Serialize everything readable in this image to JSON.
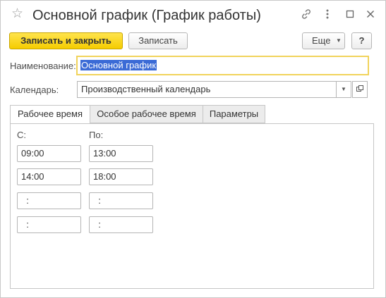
{
  "window": {
    "title": "Основной график (График работы)"
  },
  "icons": {
    "favorite": "star-icon",
    "link": "link-icon",
    "more": "more-vertical-icon",
    "maximize": "maximize-icon",
    "close": "close-icon"
  },
  "toolbar": {
    "save_close_label": "Записать и закрыть",
    "save_label": "Записать",
    "more_label": "Еще",
    "help_label": "?"
  },
  "form": {
    "name_label": "Наименование:",
    "name_value": "Основной график",
    "calendar_label": "Календарь:",
    "calendar_value": "Производственный календарь"
  },
  "tabs": [
    {
      "label": "Рабочее время",
      "active": true
    },
    {
      "label": "Особое рабочее время",
      "active": false
    },
    {
      "label": "Параметры",
      "active": false
    }
  ],
  "schedule": {
    "from_label": "С:",
    "to_label": "По:",
    "rows": [
      {
        "from": "09:00",
        "to": "13:00"
      },
      {
        "from": "14:00",
        "to": "18:00"
      },
      {
        "from": "  :",
        "to": "  :"
      },
      {
        "from": "  :",
        "to": "  :"
      }
    ]
  },
  "colors": {
    "primary_button": "#f5cc00",
    "focus_border": "#f1d35b",
    "selection": "#3b6bd6"
  }
}
